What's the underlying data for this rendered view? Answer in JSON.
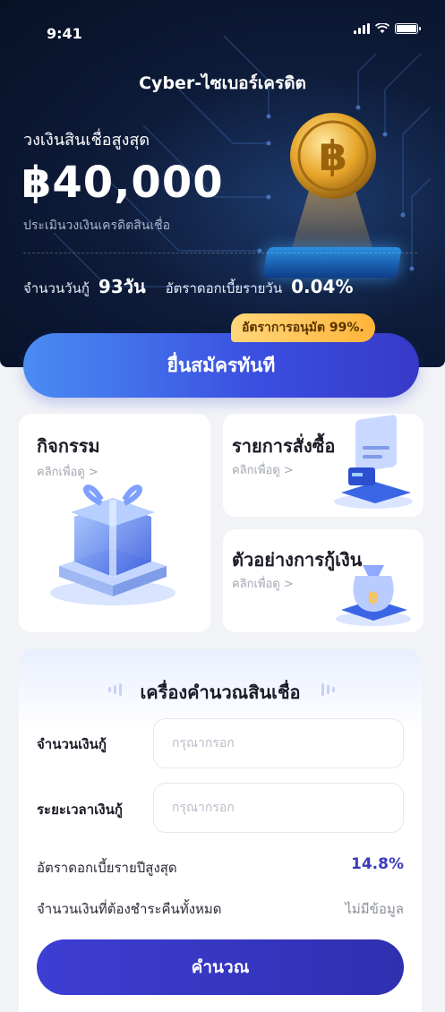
{
  "status_bar": {
    "time": "9:41"
  },
  "hero": {
    "app_title": "Cyber-ไซเบอร์เครดิต",
    "limit_label": "วงเงินสินเชื่อสูงสุด",
    "limit_amount": "฿40,000",
    "limit_sub": "ประเมินวงเงินเครดิตสินเชื่อ",
    "loan_days_label": "จำนวนวันกู้",
    "loan_days_value": "93วัน",
    "daily_rate_label": "อัตราดอกเบี้ยรายวัน",
    "daily_rate_value": "0.04%"
  },
  "apply": {
    "badge": "อัตราการอนุมัต 99%.",
    "button_label": "ยื่นสมัครทันที"
  },
  "cards": {
    "activity": {
      "title": "กิจกรรม",
      "sub": "คลิกเพื่อดู >"
    },
    "orders": {
      "title": "รายการสั่งซื้อ",
      "sub": "คลิกเพื่อดู >"
    },
    "loan_example": {
      "title": "ตัวอย่างการกู้เงิน",
      "sub": "คลิกเพื่อดู >"
    }
  },
  "calculator": {
    "title": "เครื่องคำนวณสินเชื่อ",
    "amount_label": "จำนวนเงินกู้",
    "amount_placeholder": "กรุณากรอก",
    "term_label": "ระยะเวลาเงินกู้",
    "term_placeholder": "กรุณากรอก",
    "annual_rate_label": "อัตราดอกเบี้ยรายปีสูงสุด",
    "annual_rate_value": "14.8%",
    "total_repay_label": "จำนวนเงินที่ต้องชำระคืนทั้งหมด",
    "total_repay_value": "ไม่มีข้อมูล",
    "button_label": "คำนวณ"
  },
  "colors": {
    "hero_bg": "#0b1833",
    "primary_blue": "#3a4ee0",
    "rate_accent": "#3b3bbd",
    "badge": "#ffc04f"
  }
}
